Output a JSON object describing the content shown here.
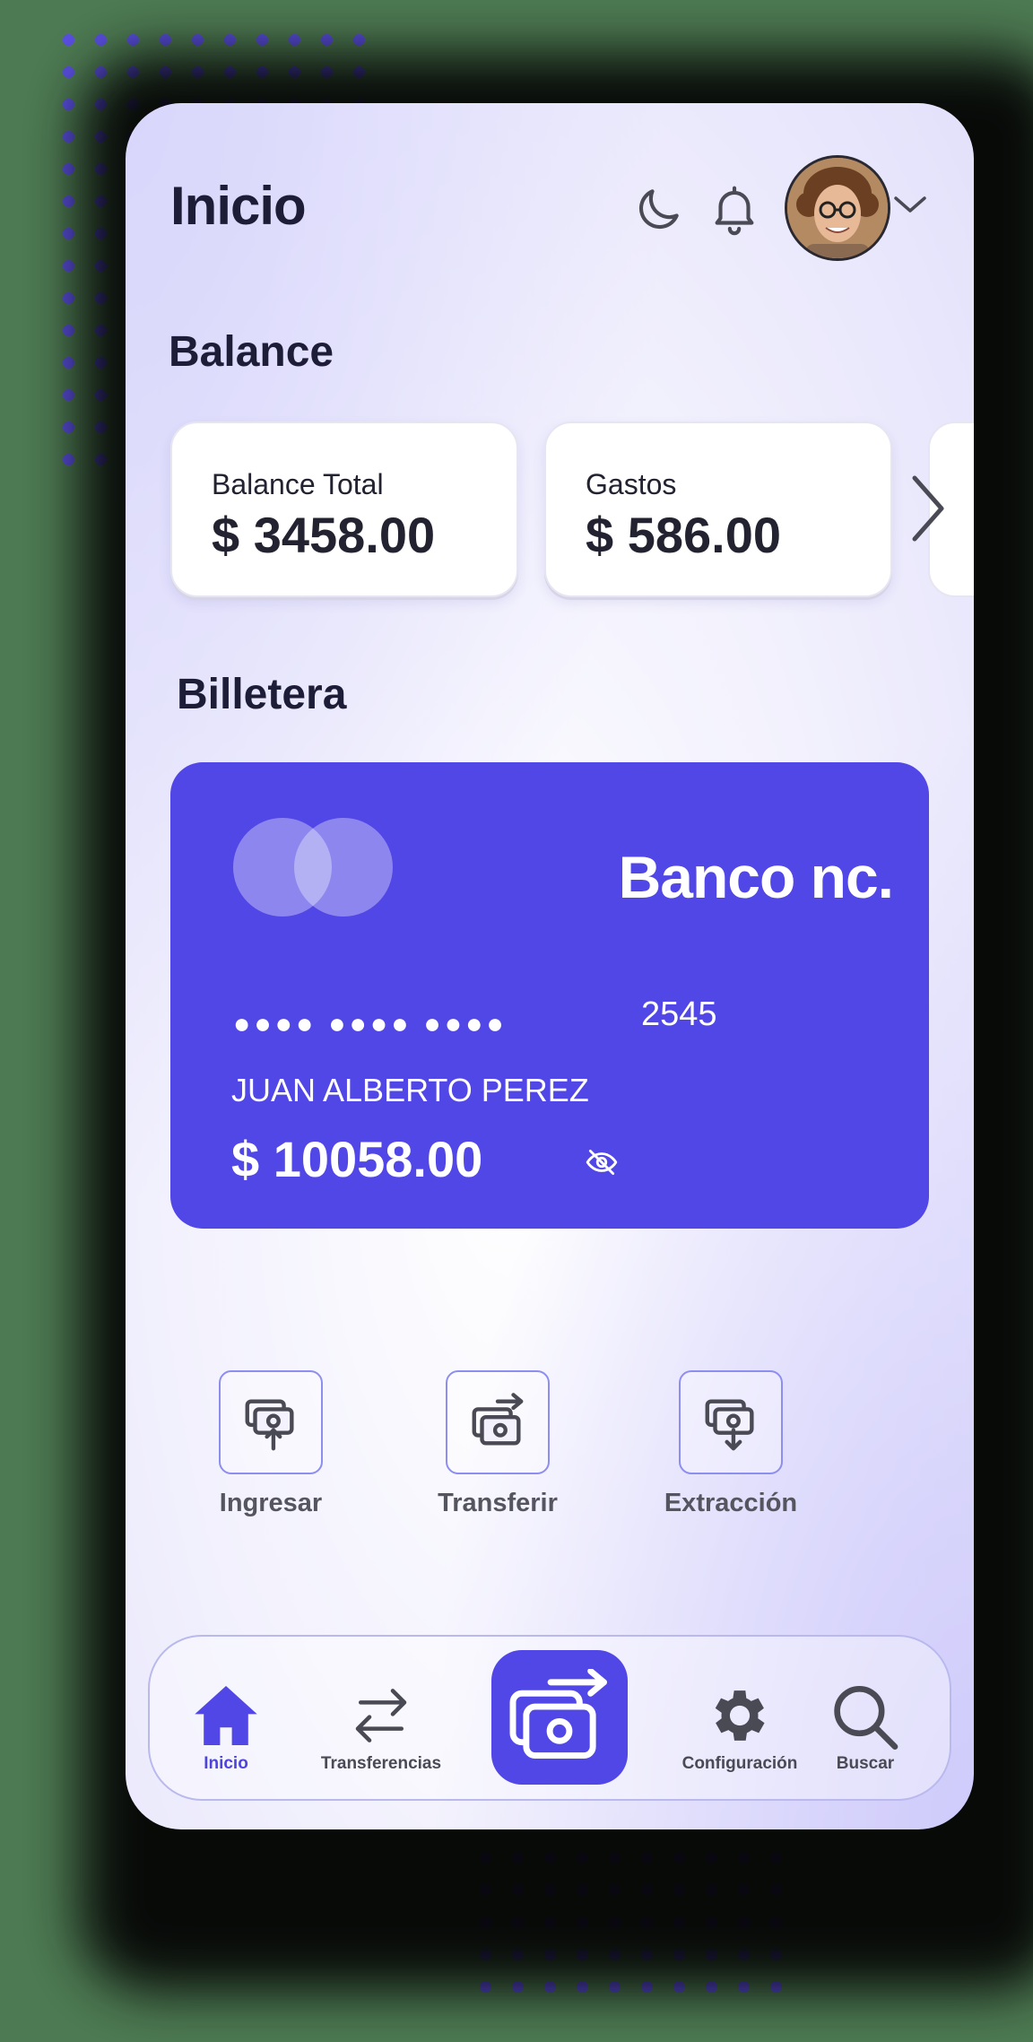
{
  "header": {
    "title": "Inicio",
    "icons": [
      "moon-icon",
      "bell-icon",
      "avatar",
      "chevron-down-icon"
    ]
  },
  "balance": {
    "section_title": "Balance",
    "cards": [
      {
        "label": "Balance Total",
        "value": "$ 3458.00"
      },
      {
        "label": "Gastos",
        "value": "$ 586.00"
      }
    ]
  },
  "wallet": {
    "section_title": "Billetera",
    "card": {
      "bank_name": "Banco nc.",
      "masked_number": "●●●● ●●●● ●●●●",
      "last4": "2545",
      "holder": "JUAN ALBERTO PEREZ",
      "amount": "$ 10058.00"
    }
  },
  "actions": [
    {
      "label": "Ingresar",
      "icon": "deposit-icon"
    },
    {
      "label": "Transferir",
      "icon": "transfer-money-icon"
    },
    {
      "label": "Extracción",
      "icon": "withdraw-icon"
    }
  ],
  "bottom_nav": {
    "items": [
      {
        "label": "Inicio",
        "icon": "home-icon",
        "active": true
      },
      {
        "label": "Transferencias",
        "icon": "arrows-icon"
      },
      {
        "label": "Configuración",
        "icon": "gear-icon"
      },
      {
        "label": "Buscar",
        "icon": "search-icon"
      }
    ],
    "center_icon": "send-money-icon"
  },
  "colors": {
    "accent": "#5146e6",
    "text_dark": "#1e1d38",
    "active_nav": "#4d45d9"
  }
}
